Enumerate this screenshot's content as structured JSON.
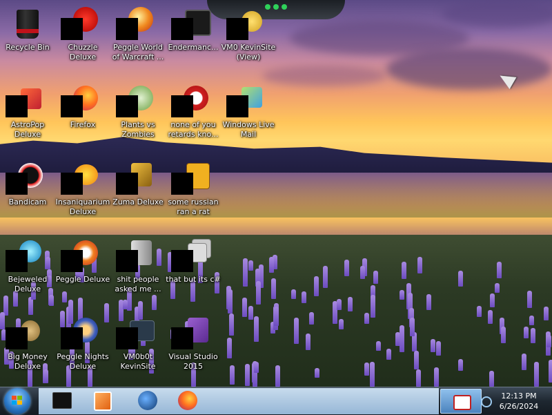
{
  "desktop": {
    "icons": [
      {
        "label": "Recycle Bin",
        "icon": "recycle-bin-icon"
      },
      {
        "label": "Chuzzle\nDeluxe",
        "icon": "chuzzle-icon"
      },
      {
        "label": "Peggle World\nof Warcraft ...",
        "icon": "peggle-wow-icon"
      },
      {
        "label": "Endermanc...",
        "icon": "terminal-icon"
      },
      {
        "label": "VM0 KevinSite\n(View)",
        "icon": "vm-site-icon"
      },
      {
        "label": "AstroPop\nDeluxe",
        "icon": "astropop-icon"
      },
      {
        "label": "Firefox",
        "icon": "firefox-icon"
      },
      {
        "label": "Plants vs\nZombies",
        "icon": "plants-vs-zombies-icon"
      },
      {
        "label": "none of you\nretards kno...",
        "icon": "bandicam-like-icon"
      },
      {
        "label": "Windows Live\nMail",
        "icon": "windows-live-mail-icon"
      },
      {
        "label": "Bandicam",
        "icon": "bandicam-icon"
      },
      {
        "label": "Insaniquarium\nDeluxe",
        "icon": "insaniquarium-icon"
      },
      {
        "label": "Zuma Deluxe",
        "icon": "zuma-icon"
      },
      {
        "label": "some russian\nran a rat",
        "icon": "adobe-file-icon"
      },
      {
        "label": "Bejeweled\nDeluxe",
        "icon": "bejeweled-icon"
      },
      {
        "label": "Peggle Deluxe",
        "icon": "peggle-icon"
      },
      {
        "label": "shit people\nasked me ...",
        "icon": "document-icon"
      },
      {
        "label": "that but its c#",
        "icon": "stacked-files-icon"
      },
      {
        "label": "Big Money\nDeluxe",
        "icon": "big-money-icon"
      },
      {
        "label": "Peggle Nights\nDeluxe",
        "icon": "peggle-nights-icon"
      },
      {
        "label": "VM0b0t\nKevinSite",
        "icon": "vm-bot-icon"
      },
      {
        "label": "Visual Studio\n2015",
        "icon": "visual-studio-icon"
      }
    ]
  },
  "taskbar": {
    "start_icon": "windows-start-orb-icon",
    "pinned": [
      {
        "icon": "terminal-app-icon"
      },
      {
        "icon": "media-player-icon"
      },
      {
        "icon": "globe-app-icon"
      },
      {
        "icon": "firefox-taskbar-icon"
      }
    ],
    "tray_icon": "tray-app-icon",
    "clock": {
      "time": "12:13 PM",
      "date": "6/26/2024"
    }
  },
  "colors": {
    "taskbar": "#1e2730",
    "label_text": "#ffffff"
  }
}
